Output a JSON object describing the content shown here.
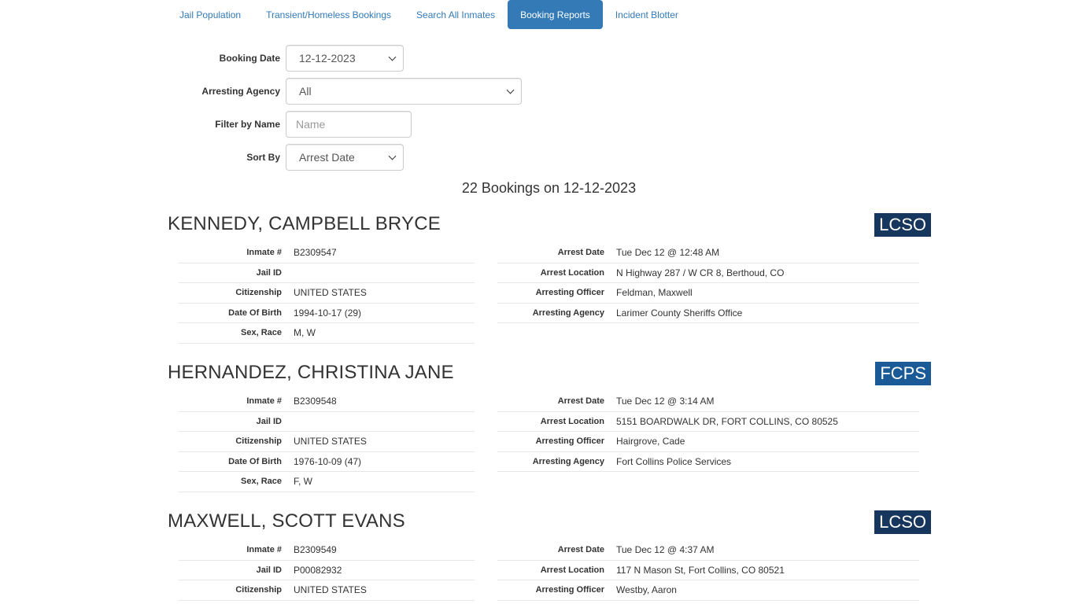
{
  "tabs": [
    {
      "label": "Jail Population",
      "active": false
    },
    {
      "label": "Transient/Homeless Bookings",
      "active": false
    },
    {
      "label": "Search All Inmates",
      "active": false
    },
    {
      "label": "Booking Reports",
      "active": true
    },
    {
      "label": "Incident Blotter",
      "active": false
    }
  ],
  "filters": {
    "booking_date": {
      "label": "Booking Date",
      "value": "12-12-2023"
    },
    "arresting_agency": {
      "label": "Arresting Agency",
      "value": "All"
    },
    "filter_name": {
      "label": "Filter by Name",
      "placeholder": "Name"
    },
    "sort_by": {
      "label": "Sort By",
      "value": "Arrest Date"
    }
  },
  "summary": "22 Bookings on 12-12-2023",
  "field_labels": {
    "inmate": "Inmate #",
    "jail_id": "Jail ID",
    "citizenship": "Citizenship",
    "dob": "Date Of Birth",
    "sex_race": "Sex, Race",
    "arrest_date": "Arrest Date",
    "arrest_location": "Arrest Location",
    "arresting_officer": "Arresting Officer",
    "arresting_agency": "Arresting Agency"
  },
  "bookings": [
    {
      "name": "KENNEDY, CAMPBELL BRYCE",
      "agency_badge": "LCSO",
      "inmate": "B2309547",
      "jail_id": "",
      "citizenship": "UNITED STATES",
      "dob": "1994-10-17 (29)",
      "sex_race": "M, W",
      "arrest_date": "Tue Dec 12 @ 12:48 AM",
      "arrest_location": "N Highway 287 / W CR 8, Berthoud, CO",
      "arresting_officer": "Feldman, Maxwell",
      "arresting_agency": "Larimer County Sheriffs Office"
    },
    {
      "name": "HERNANDEZ, CHRISTINA JANE",
      "agency_badge": "FCPS",
      "inmate": "B2309548",
      "jail_id": "",
      "citizenship": "UNITED STATES",
      "dob": "1976-10-09 (47)",
      "sex_race": "F, W",
      "arrest_date": "Tue Dec 12 @ 3:14 AM",
      "arrest_location": "5151 BOARDWALK DR, FORT COLLINS, CO 80525",
      "arresting_officer": "Hairgrove, Cade",
      "arresting_agency": "Fort Collins Police Services"
    },
    {
      "name": "MAXWELL, SCOTT EVANS",
      "agency_badge": "LCSO",
      "inmate": "B2309549",
      "jail_id": "P00082932",
      "citizenship": "UNITED STATES",
      "arrest_date": "Tue Dec 12 @ 4:37 AM",
      "arrest_location": "117 N Mason St, Fort Collins, CO 80521",
      "arresting_officer": "Westby, Aaron"
    }
  ],
  "colors": {
    "accent": "#337ab7",
    "badge_lcso": "#17365d",
    "badge_fcps": "#1a5a96"
  }
}
